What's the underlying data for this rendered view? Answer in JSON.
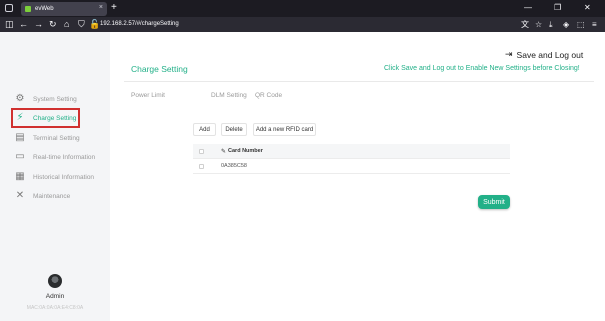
{
  "browser": {
    "tab_title": "evWeb",
    "tab_close": "×",
    "new_tab": "+",
    "url": "192.168.2.57/#/chargeSetting",
    "min": "—",
    "max": "❐",
    "close": "✕"
  },
  "sidebar": {
    "items": [
      {
        "label": "System Setting",
        "icon": "gear-icon",
        "glyph": "⚙"
      },
      {
        "label": "Charge Setting",
        "icon": "charging-bolt-icon",
        "glyph": "⚡"
      },
      {
        "label": "Terminal Setting",
        "icon": "terminal-icon",
        "glyph": "▤"
      },
      {
        "label": "Real-time Information",
        "icon": "monitor-icon",
        "glyph": "▭"
      },
      {
        "label": "Historical Information",
        "icon": "document-icon",
        "glyph": "▦"
      },
      {
        "label": "Maintenance",
        "icon": "tools-icon",
        "glyph": "✕"
      }
    ],
    "user": "Admin",
    "mac": "MAC:0A:0A:0A:E4:C8:0A"
  },
  "header": {
    "logout_label": "Save and Log out",
    "logout_glyph": "⇥",
    "page_title": "Charge Setting",
    "warning": "Click Save and Log out to Enable New Settings before Closing!"
  },
  "subtabs": [
    "Power Limit",
    "DLM Setting",
    "QR Code"
  ],
  "toolbar": {
    "add": "Add",
    "delete": "Delete",
    "add_rfid": "Add a new RFID card"
  },
  "table": {
    "header": "Card Number",
    "rows": [
      "0A385C58"
    ]
  },
  "submit": "Submit",
  "colors": {
    "accent": "#22b088",
    "highlight_border": "#d0302f"
  }
}
